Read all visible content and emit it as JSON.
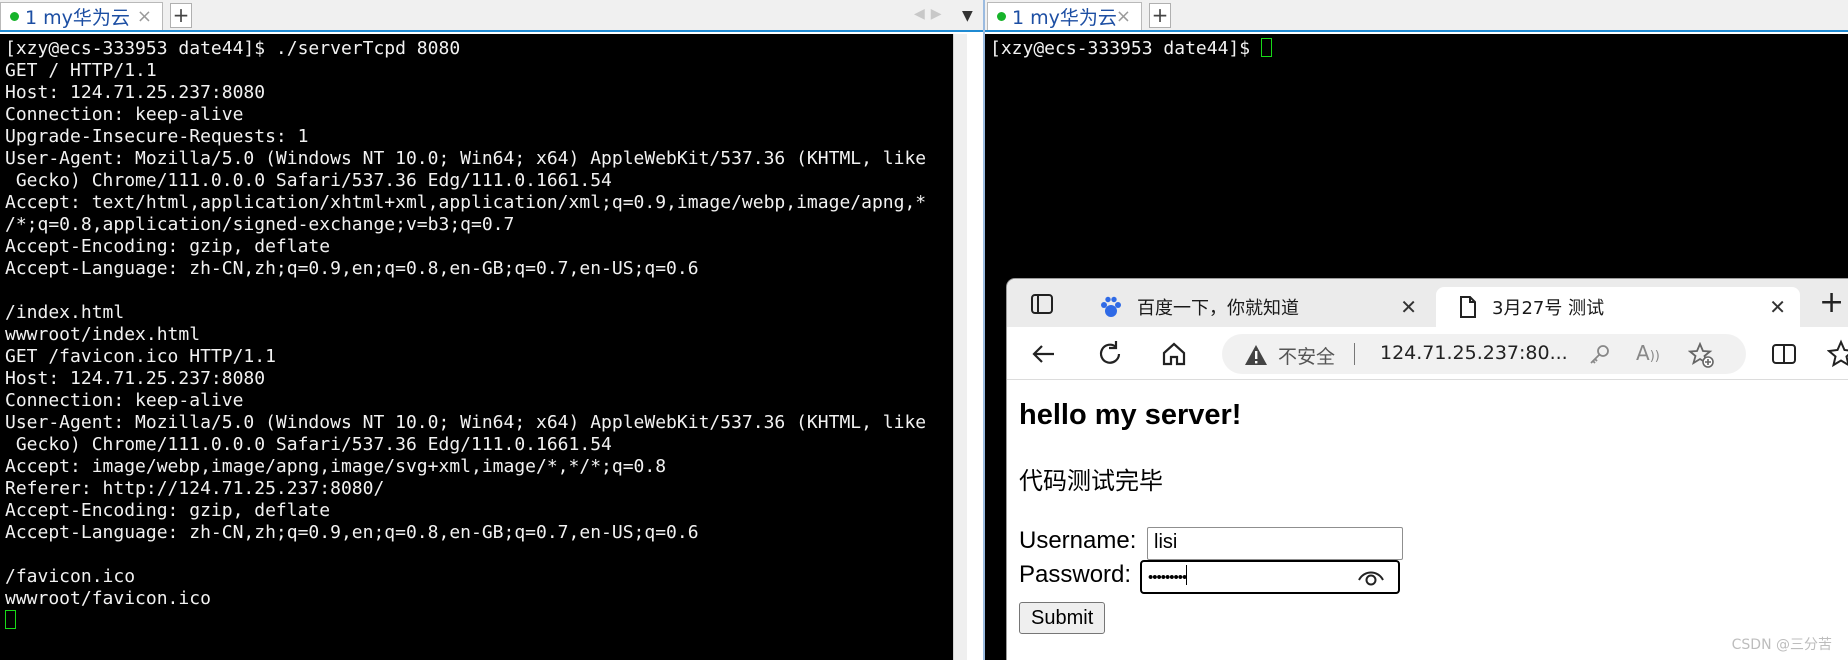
{
  "left_pane": {
    "tab_label": "1 my华为云",
    "tab_close": "×",
    "new_tab": "+",
    "terminal_lines": [
      "[xzy@ecs-333953 date44]$ ./serverTcpd 8080",
      "GET / HTTP/1.1",
      "Host: 124.71.25.237:8080",
      "Connection: keep-alive",
      "Upgrade-Insecure-Requests: 1",
      "User-Agent: Mozilla/5.0 (Windows NT 10.0; Win64; x64) AppleWebKit/537.36 (KHTML, like",
      " Gecko) Chrome/111.0.0.0 Safari/537.36 Edg/111.0.1661.54",
      "Accept: text/html,application/xhtml+xml,application/xml;q=0.9,image/webp,image/apng,*",
      "/*;q=0.8,application/signed-exchange;v=b3;q=0.7",
      "Accept-Encoding: gzip, deflate",
      "Accept-Language: zh-CN,zh;q=0.9,en;q=0.8,en-GB;q=0.7,en-US;q=0.6",
      "",
      "/index.html",
      "wwwroot/index.html",
      "GET /favicon.ico HTTP/1.1",
      "Host: 124.71.25.237:8080",
      "Connection: keep-alive",
      "User-Agent: Mozilla/5.0 (Windows NT 10.0; Win64; x64) AppleWebKit/537.36 (KHTML, like",
      " Gecko) Chrome/111.0.0.0 Safari/537.36 Edg/111.0.1661.54",
      "Accept: image/webp,image/apng,image/svg+xml,image/*,*/*;q=0.8",
      "Referer: http://124.71.25.237:8080/",
      "Accept-Encoding: gzip, deflate",
      "Accept-Language: zh-CN,zh;q=0.9,en;q=0.8,en-GB;q=0.7,en-US;q=0.6",
      "",
      "/favicon.ico",
      "wwwroot/favicon.ico"
    ]
  },
  "right_pane": {
    "tab_label": "1 my华为云",
    "tab_close": "×",
    "new_tab": "+",
    "prompt": "[xzy@ecs-333953 date44]$ "
  },
  "browser": {
    "tabs": [
      {
        "label": "百度一下，你就知道",
        "icon": "baidu-paw-icon"
      },
      {
        "label": "3月27号 测试",
        "icon": "document-icon"
      }
    ],
    "address": {
      "security_label": "不安全",
      "url": "124.71.25.237:80..."
    },
    "page": {
      "heading": "hello my server!",
      "paragraph": "代码测试完毕",
      "username_label": "Username:",
      "username_value": "lisi",
      "password_label": "Password:",
      "password_masked": "•••••••••",
      "submit_label": "Submit"
    }
  },
  "watermark": "CSDN @三分苦",
  "colors": {
    "terminal_bg": "#000000",
    "terminal_fg": "#f2f2f2",
    "cursor": "#18d818",
    "tab_text": "#1c4ea3"
  }
}
